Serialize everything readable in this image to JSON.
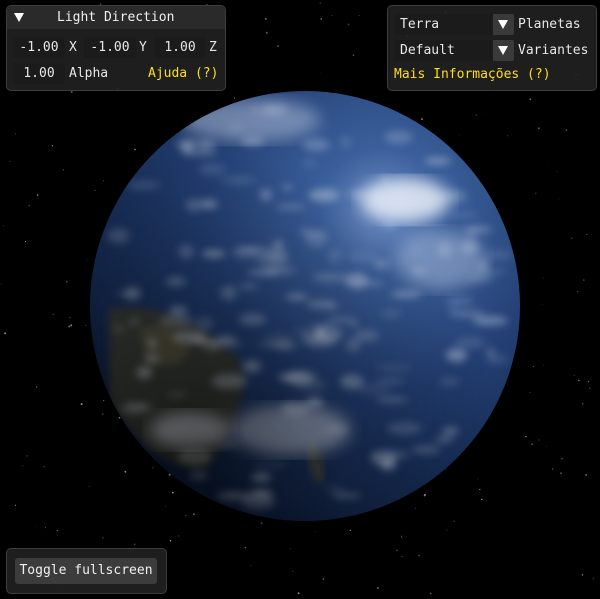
{
  "light_panel": {
    "title": "Light Direction",
    "x_value": "-1.00",
    "x_label": "X",
    "y_value": "-1.00",
    "y_label": "Y",
    "z_value": "1.00",
    "z_label": "Z",
    "alpha_value": "1.00",
    "alpha_label": "Alpha",
    "help_label": "Ajuda (?)"
  },
  "planet_panel": {
    "planet_value": "Terra",
    "planet_label": "Planetas",
    "variant_value": "Default",
    "variant_label": "Variantes",
    "more_info_label": "Mais Informações (?)"
  },
  "toggle": {
    "label": "Toggle fullscreen"
  },
  "colors": {
    "help_text": "#ffde1c",
    "panel_bg": "#202020",
    "ocean": "#1d3a6b",
    "space": "#000000"
  }
}
